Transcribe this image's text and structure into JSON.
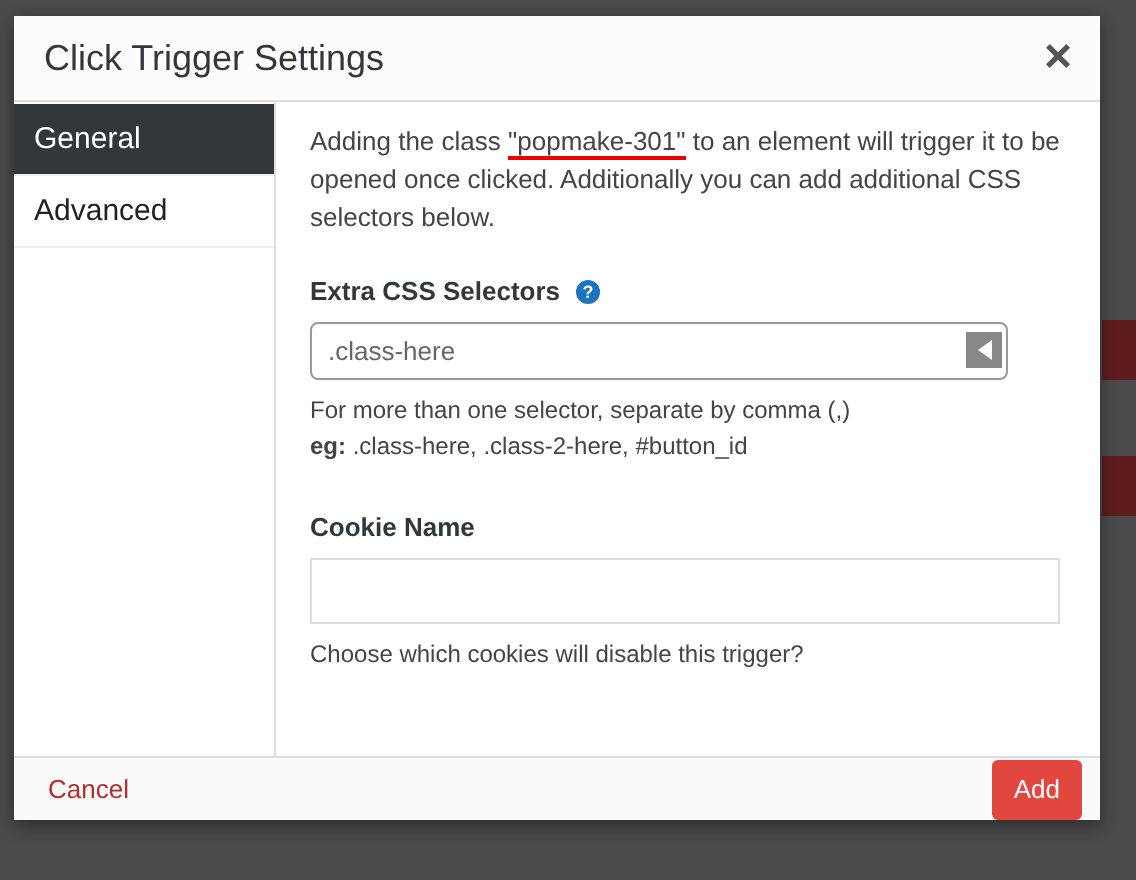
{
  "dialog": {
    "title": "Click Trigger Settings",
    "close": "×"
  },
  "tabs": [
    {
      "label": "General",
      "selected": true
    },
    {
      "label": "Advanced",
      "selected": false
    }
  ],
  "intro": {
    "before": "Adding the class ",
    "class_name": "\"popmake-301\"",
    "after": " to an element will trigger it to be opened once clicked. Additionally you can add additional CSS selectors below."
  },
  "extra_css": {
    "label": "Extra CSS Selectors",
    "help": "?",
    "placeholder": ".class-here",
    "hint": "For more than one selector, separate by comma (,)",
    "example": "**eg:** .class-here, .class-2-here, #button_id"
  },
  "cookie": {
    "label": "Cookie Name",
    "hint": "Choose which cookies will disable this trigger?"
  },
  "footer": {
    "cancel": "Cancel",
    "add": "Add"
  }
}
